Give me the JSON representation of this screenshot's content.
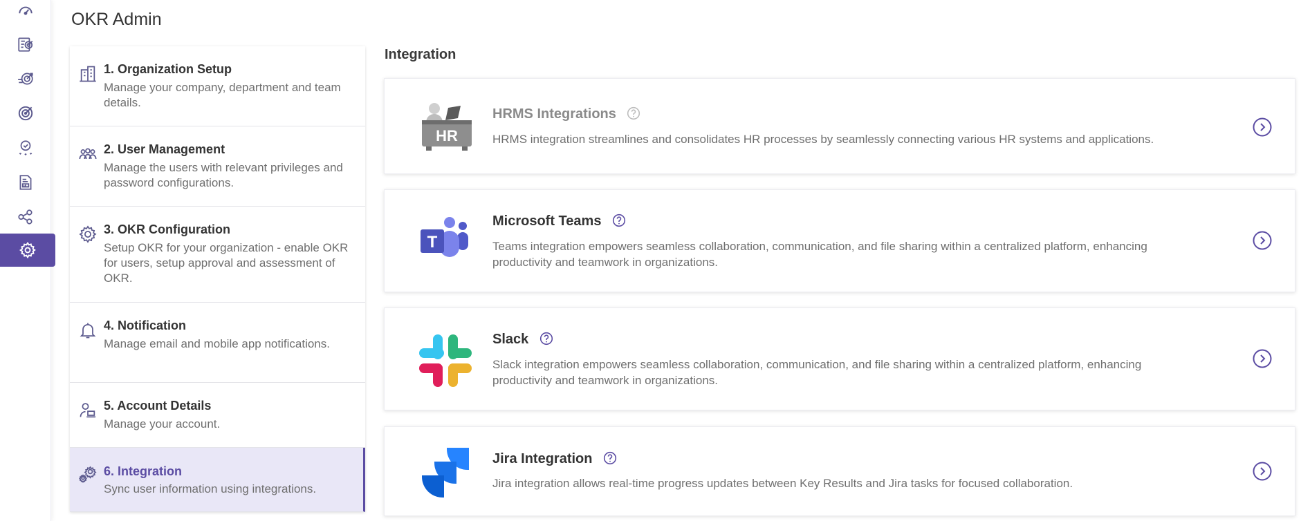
{
  "app": {
    "title": "OKR Admin"
  },
  "rail": {
    "items": [
      {
        "icon": "speedometer-icon"
      },
      {
        "icon": "okr-list-icon"
      },
      {
        "icon": "target-arrow-icon"
      },
      {
        "icon": "target-icon"
      },
      {
        "icon": "award-badge-icon"
      },
      {
        "icon": "report-document-icon"
      },
      {
        "icon": "network-nodes-icon"
      },
      {
        "icon": "gear-icon",
        "active": true
      }
    ]
  },
  "menu": {
    "items": [
      {
        "title": "1. Organization Setup",
        "desc": "Manage your company, department and team details.",
        "icon": "building-icon"
      },
      {
        "title": "2. User Management",
        "desc": "Manage the users with relevant privileges and password configurations.",
        "icon": "users-group-icon"
      },
      {
        "title": "3. OKR Configuration",
        "desc": "Setup OKR for your organization - enable OKR for users, setup approval and assessment of OKR.",
        "icon": "gear-outline-icon"
      },
      {
        "title": "4. Notification",
        "desc": "Manage email and mobile app notifications.",
        "icon": "bell-icon"
      },
      {
        "title": "5. Account Details",
        "desc": "Manage your account.",
        "icon": "user-laptop-icon"
      },
      {
        "title": "6. Integration",
        "desc": "Sync user information using integrations.",
        "icon": "gears-icon",
        "active": true
      }
    ]
  },
  "integration": {
    "section_title": "Integration",
    "cards": [
      {
        "title": "HRMS Integrations",
        "desc": "HRMS integration streamlines and consolidates HR processes by seamlessly connecting various HR systems and applications.",
        "logo": "hr-desk-logo",
        "logo_text": "HR",
        "disabled": true
      },
      {
        "title": "Microsoft Teams",
        "desc": "Teams integration empowers seamless collaboration, communication, and file sharing within a centralized platform, enhancing productivity and teamwork in organizations.",
        "logo": "microsoft-teams-logo",
        "logo_text": "T"
      },
      {
        "title": "Slack",
        "desc": "Slack integration empowers seamless collaboration, communication, and file sharing within a centralized platform, enhancing productivity and teamwork in organizations.",
        "logo": "slack-logo"
      },
      {
        "title": "Jira Integration",
        "desc": "Jira integration allows real-time progress updates between Key Results and Jira tasks for focused collaboration.",
        "logo": "jira-logo"
      }
    ]
  },
  "colors": {
    "accent": "#5b4ca3",
    "active_bg": "#e9e7f7",
    "muted_text": "#6f6f6f"
  }
}
